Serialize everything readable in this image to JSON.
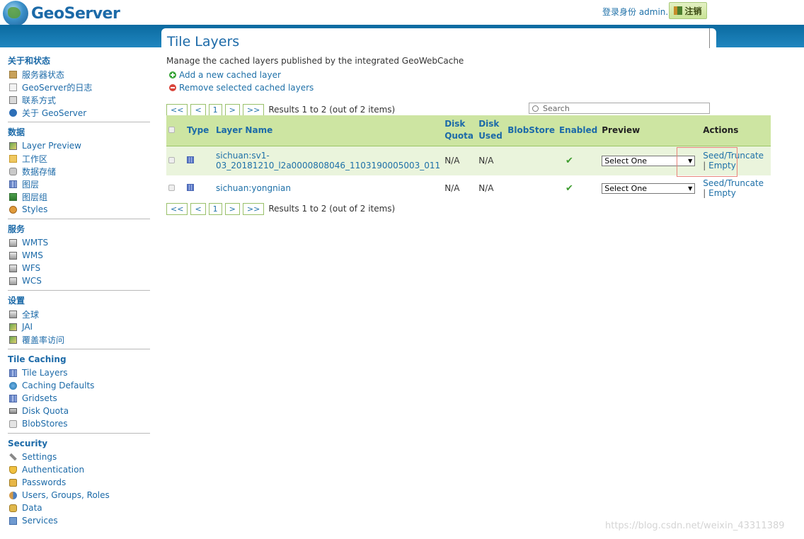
{
  "header": {
    "logo_text": "GeoServer",
    "login_status": "登录身份 admin.",
    "logout_label": "注销"
  },
  "sidebar": {
    "sections": [
      {
        "title": "关于和状态",
        "items": [
          {
            "label": "服务器状态",
            "icon": "server-status-icon"
          },
          {
            "label": "GeoServer的日志",
            "icon": "log-icon"
          },
          {
            "label": "联系方式",
            "icon": "contact-icon"
          },
          {
            "label": "关于 GeoServer",
            "icon": "info-icon"
          }
        ]
      },
      {
        "title": "数据",
        "items": [
          {
            "label": "Layer Preview",
            "icon": "map-icon"
          },
          {
            "label": "工作区",
            "icon": "folder-icon"
          },
          {
            "label": "数据存储",
            "icon": "datastore-icon"
          },
          {
            "label": "图层",
            "icon": "layer-icon"
          },
          {
            "label": "图层组",
            "icon": "layer-group-icon"
          },
          {
            "label": "Styles",
            "icon": "style-icon"
          }
        ]
      },
      {
        "title": "服务",
        "items": [
          {
            "label": "WMTS",
            "icon": "service-icon"
          },
          {
            "label": "WMS",
            "icon": "service-icon"
          },
          {
            "label": "WFS",
            "icon": "service-icon"
          },
          {
            "label": "WCS",
            "icon": "service-icon"
          }
        ]
      },
      {
        "title": "设置",
        "items": [
          {
            "label": "全球",
            "icon": "server-icon"
          },
          {
            "label": "JAI",
            "icon": "map-icon"
          },
          {
            "label": "覆盖率访问",
            "icon": "map-icon"
          }
        ]
      },
      {
        "title": "Tile Caching",
        "items": [
          {
            "label": "Tile Layers",
            "icon": "grid-icon"
          },
          {
            "label": "Caching Defaults",
            "icon": "globe-icon"
          },
          {
            "label": "Gridsets",
            "icon": "grid-icon"
          },
          {
            "label": "Disk Quota",
            "icon": "disk-icon"
          },
          {
            "label": "BlobStores",
            "icon": "blob-icon"
          }
        ]
      },
      {
        "title": "Security",
        "items": [
          {
            "label": "Settings",
            "icon": "wrench-icon"
          },
          {
            "label": "Authentication",
            "icon": "shield-icon"
          },
          {
            "label": "Passwords",
            "icon": "lock-icon"
          },
          {
            "label": "Users, Groups, Roles",
            "icon": "users-icon"
          },
          {
            "label": "Data",
            "icon": "data-icon"
          },
          {
            "label": "Services",
            "icon": "services-icon"
          }
        ]
      }
    ]
  },
  "main": {
    "title": "Tile Layers",
    "description": "Manage the cached layers published by the integrated GeoWebCache",
    "add_link": "Add a new cached layer",
    "remove_link": "Remove selected cached layers",
    "search_placeholder": "Search",
    "pager": {
      "first": "<<",
      "prev": "<",
      "page": "1",
      "next": ">",
      "last": ">>",
      "results": "Results 1 to 2 (out of 2 items)"
    },
    "table": {
      "headers": {
        "type": "Type",
        "layer_name": "Layer Name",
        "disk_quota_1": "Disk",
        "disk_quota_2": "Quota",
        "disk_used_1": "Disk",
        "disk_used_2": "Used",
        "blobstore": "BlobStore",
        "enabled": "Enabled",
        "preview": "Preview",
        "actions": "Actions"
      },
      "rows": [
        {
          "layer_name_1": "sichuan:sv1-",
          "layer_name_2": "03_20181210_l2a0000808046_1103190005003_011",
          "disk_quota": "N/A",
          "disk_used": "N/A",
          "blobstore": "",
          "enabled": "✔",
          "preview": "Select One",
          "seed": "Seed/Truncate",
          "sep": "|",
          "empty": "Empty"
        },
        {
          "layer_name_1": "sichuan:yongnian",
          "layer_name_2": "",
          "disk_quota": "N/A",
          "disk_used": "N/A",
          "blobstore": "",
          "enabled": "✔",
          "preview": "Select One",
          "seed": "Seed/Truncate",
          "sep": "|",
          "empty": "Empty"
        }
      ]
    }
  },
  "watermark": "https://blog.csdn.net/weixin_43311389",
  "colors": {
    "accent": "#1c6aa8",
    "header_band": "#0b6aa0",
    "table_header": "#cde5a2",
    "highlight": "#e8847a"
  }
}
